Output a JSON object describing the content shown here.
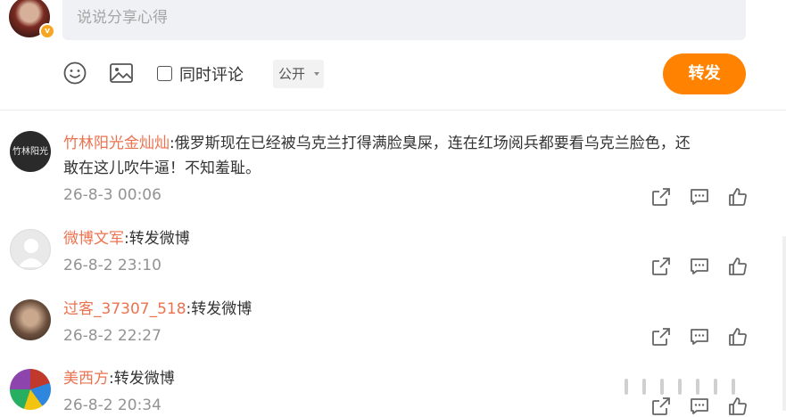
{
  "composer": {
    "placeholder": "说说分享心得",
    "also_comment_label": "同时评论",
    "visibility": "公开",
    "forward_label": "转发"
  },
  "comments": [
    {
      "name": "竹林阳光金灿灿",
      "sep": ":",
      "line1": "俄罗斯现在已经被乌克兰打得满脸臭屎，连在红场阅兵都要看乌克兰脸色，还",
      "line2": "敢在这儿吹牛逼！不知羞耻。",
      "time": "26-8-3 00:06",
      "avatar_text": "竹林阳光"
    },
    {
      "name": "微博文军",
      "sep": ":",
      "line1": "转发微博",
      "time": "26-8-2 23:10"
    },
    {
      "name": "过客_37307_518",
      "sep": ":",
      "line1": "转发微博",
      "time": "26-8-2 22:27"
    },
    {
      "name": "美西方",
      "sep": ":",
      "line1": "转发微博",
      "time": "26-8-2 20:34"
    }
  ],
  "colors": {
    "accent": "#ff8200",
    "name": "#eb7350",
    "time": "#939393"
  }
}
